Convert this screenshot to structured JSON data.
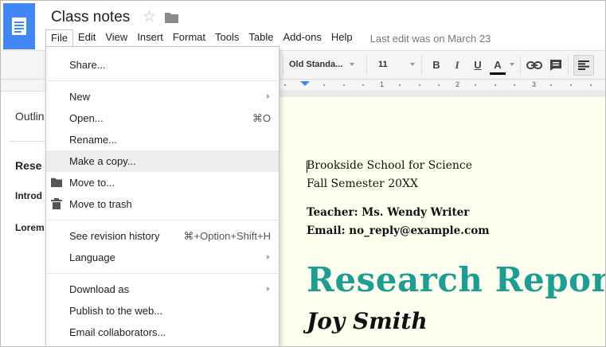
{
  "header": {
    "doc_title": "Class notes",
    "star_glyph": "☆",
    "last_edit": "Last edit was on March 23"
  },
  "menubar": {
    "items": [
      {
        "label": "File"
      },
      {
        "label": "Edit"
      },
      {
        "label": "View"
      },
      {
        "label": "Insert"
      },
      {
        "label": "Format"
      },
      {
        "label": "Tools"
      },
      {
        "label": "Table"
      },
      {
        "label": "Add-ons"
      },
      {
        "label": "Help"
      }
    ]
  },
  "toolbar": {
    "font_family": "Old Standa...",
    "font_size": "11",
    "bold_glyph": "B",
    "italic_glyph": "I",
    "underline_glyph": "U",
    "text_color_glyph": "A",
    "text_color": "#000000"
  },
  "ruler": {
    "numbers": [
      "1",
      "2",
      "3"
    ]
  },
  "outline": {
    "title": "Outlin",
    "items": [
      "Rese",
      "Introd",
      "Lorem"
    ]
  },
  "file_menu": {
    "items": [
      {
        "label": "Share...",
        "shortcut": "",
        "submenu": false,
        "icon": ""
      },
      {
        "label": "New",
        "shortcut": "",
        "submenu": true,
        "icon": ""
      },
      {
        "label": "Open...",
        "shortcut": "⌘O",
        "submenu": false,
        "icon": ""
      },
      {
        "label": "Rename...",
        "shortcut": "",
        "submenu": false,
        "icon": ""
      },
      {
        "label": "Make a copy...",
        "shortcut": "",
        "submenu": false,
        "icon": "",
        "highlighted": true
      },
      {
        "label": "Move to...",
        "shortcut": "",
        "submenu": false,
        "icon": "folder-icon"
      },
      {
        "label": "Move to trash",
        "shortcut": "",
        "submenu": false,
        "icon": "trash-icon"
      },
      {
        "label": "See revision history",
        "shortcut": "⌘+Option+Shift+H",
        "submenu": false,
        "icon": ""
      },
      {
        "label": "Language",
        "shortcut": "",
        "submenu": true,
        "icon": ""
      },
      {
        "label": "Download as",
        "shortcut": "",
        "submenu": true,
        "icon": ""
      },
      {
        "label": "Publish to the web...",
        "shortcut": "",
        "submenu": false,
        "icon": ""
      },
      {
        "label": "Email collaborators...",
        "shortcut": "",
        "submenu": false,
        "icon": ""
      }
    ]
  },
  "document": {
    "school": "Brookside School for Science",
    "semester": "Fall Semester 20XX",
    "teacher": "Teacher: Ms. Wendy Writer",
    "email": "Email: no_reply@example.com",
    "title": "Research Report",
    "title_color": "#1e9e93",
    "author": "Joy Smith"
  },
  "colors": {
    "brand_blue": "#4285f4",
    "page_bg": "#fffff0",
    "menu_highlight": "#eeeeee"
  }
}
